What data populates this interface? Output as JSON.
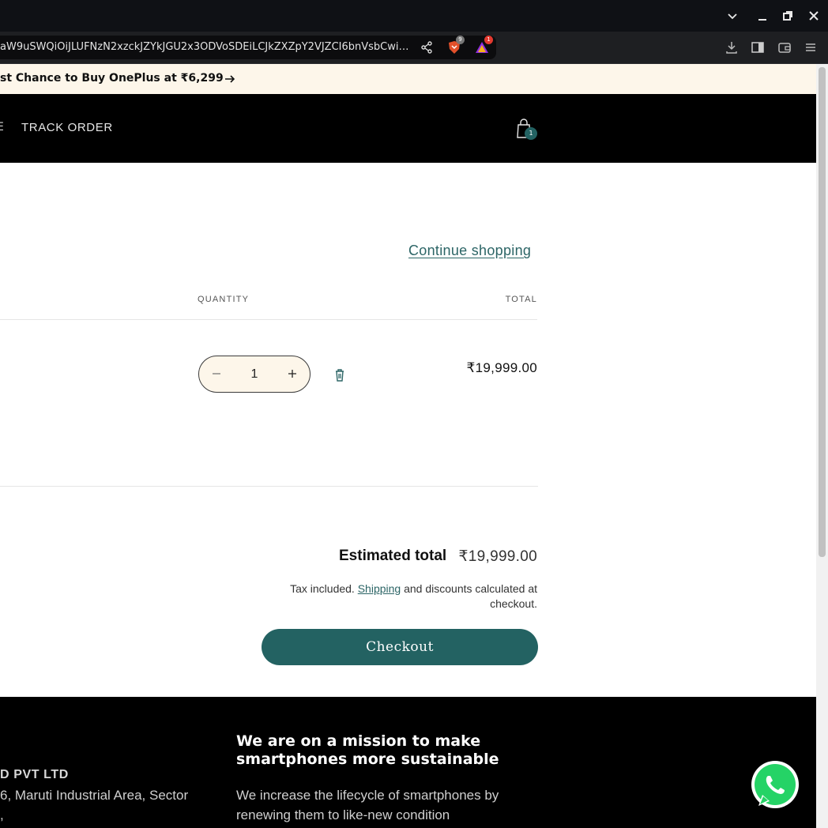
{
  "browser": {
    "url": "aW9uSWQiOiJLUFNzN2xzckJZYkJGU2x3ODVoSDEiLCJkZXZpY2VJZCI6bnVsbCwi…",
    "brave_badge": "9",
    "rewards_badge": "1"
  },
  "announcement": {
    "text": "st Chance to Buy OnePlus at ₹6,299"
  },
  "header": {
    "nav_fragment": "E",
    "track_order": "TRACK ORDER",
    "cart_count": "1"
  },
  "cart": {
    "continue_shopping": "Continue shopping",
    "col_quantity": "QUANTITY",
    "col_total": "TOTAL",
    "item": {
      "quantity": "1",
      "line_total": "₹19,999.00"
    },
    "estimated_total_label": "Estimated total",
    "estimated_total_value": "₹19,999.00",
    "tax_prefix": "Tax included.",
    "tax_link": "Shipping",
    "tax_suffix": "and discounts calculated at checkout.",
    "checkout_label": "Checkout"
  },
  "footer": {
    "company": "D PVT LTD",
    "address_line1": "6, Maruti Industrial Area, Sector",
    "address_line2": ",",
    "mission_title": "We are on a mission to make smartphones more sustainable",
    "mission_desc": "We increase the lifecycle of smartphones by renewing them to like-new condition"
  },
  "colors": {
    "accent": "#236262",
    "announce_bg": "#fdf6ea",
    "header_bg": "#000000",
    "whatsapp": "#25d366"
  },
  "icons": [
    "chevron-down-icon",
    "minimize-icon",
    "restore-icon",
    "close-icon",
    "share-icon",
    "brave-shield-icon",
    "rewards-icon",
    "download-icon",
    "sidebar-icon",
    "wallet-icon",
    "menu-icon",
    "arrow-right-icon",
    "cart-bag-icon",
    "minus-icon",
    "plus-icon",
    "trash-icon",
    "whatsapp-icon"
  ]
}
